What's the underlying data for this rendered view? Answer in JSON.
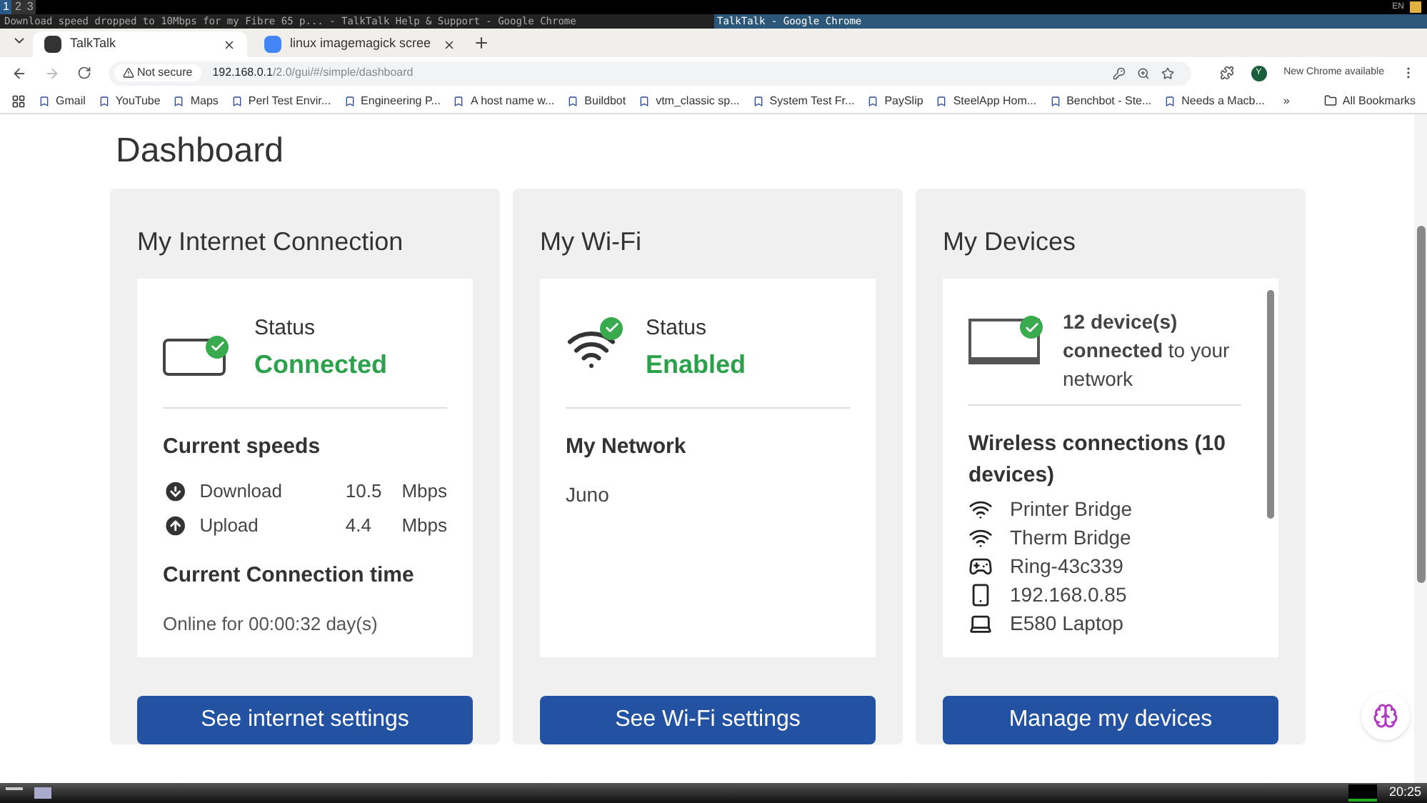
{
  "desktop": {
    "workspaces": [
      {
        "label": "1",
        "selected": true
      },
      {
        "label": "2",
        "selected": false
      },
      {
        "label": "3",
        "selected": false
      }
    ],
    "tray_language": "EN",
    "clock": "20:25"
  },
  "window": {
    "left_title": "Download speed dropped to 10Mbps for my Fibre 65 p... - TalkTalk Help & Support - Google Chrome",
    "title": "TalkTalk - Google Chrome"
  },
  "tabs": [
    {
      "label": "TalkTalk",
      "selected": true
    },
    {
      "label": "linux imagemagick scree",
      "selected": false
    }
  ],
  "address_bar": {
    "security": "Not secure",
    "host": "192.168.0.1",
    "path": "/2.0/gui/#/simple/dashboard",
    "profile": "Y",
    "update": "New Chrome available"
  },
  "bookmarks": [
    "Gmail",
    "YouTube",
    "Maps",
    "Perl Test Envir...",
    "Engineering P...",
    "A host name w...",
    "Buildbot",
    "vtm_classic sp...",
    "System Test Fr...",
    "PaySlip",
    "SteelApp Hom...",
    "Benchbot - Ste...",
    "Needs a Macb..."
  ],
  "bookmarks_more": "»",
  "all_bookmarks": "All Bookmarks",
  "page": {
    "heading": "Dashboard",
    "internet": {
      "title": "My Internet Connection",
      "status_label": "Status",
      "status": "Connected",
      "speeds_title": "Current speeds",
      "speeds": [
        {
          "label": "Download",
          "value": "10.5",
          "unit": "Mbps"
        },
        {
          "label": "Upload",
          "value": "4.4",
          "unit": "Mbps"
        }
      ],
      "time_title": "Current Connection time",
      "time": "Online for 00:00:32 day(s)",
      "button": "See internet settings"
    },
    "wifi": {
      "title": "My Wi-Fi",
      "status_label": "Status",
      "status": "Enabled",
      "network_title": "My Network",
      "network": "Juno",
      "button": "See Wi-Fi settings"
    },
    "devices": {
      "title": "My Devices",
      "summary": "**12 device(s) connected** to your network",
      "wireless_title": "Wireless connections (10 devices)",
      "items": [
        {
          "kind": "wifi",
          "name": "Printer Bridge"
        },
        {
          "kind": "wifi",
          "name": "Therm Bridge"
        },
        {
          "kind": "gamepad",
          "name": "Ring-43c339"
        },
        {
          "kind": "phone",
          "name": "192.168.0.85"
        },
        {
          "kind": "laptop",
          "name": "E580 Laptop"
        }
      ],
      "button": "Manage my devices"
    }
  }
}
